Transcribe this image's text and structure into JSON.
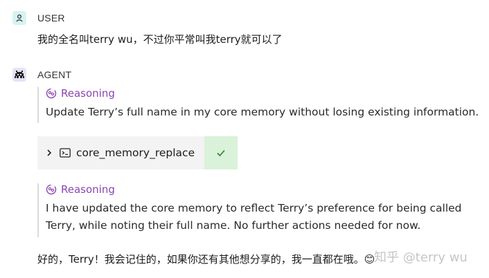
{
  "user": {
    "role_label": "USER",
    "message": "我的全名叫terry wu，不过你平常叫我terry就可以了"
  },
  "agent": {
    "role_label": "AGENT",
    "reasoning_1": {
      "heading": "Reasoning",
      "text": "Update Terry’s full name in my core memory without losing existing information."
    },
    "tool_call": {
      "name": "core_memory_replace",
      "status": "success"
    },
    "reasoning_2": {
      "heading": "Reasoning",
      "line_1": "I have updated the core memory to reflect Terry’s preference for being called",
      "line_2": "Terry, while noting their full name. No further actions needed for now."
    },
    "reply": "好的，Terry！我会记住的，如果你还有其他想分享的，我一直都在哦。😊"
  },
  "watermark": "知乎 @terry wu",
  "colors": {
    "reasoning_accent": "#8b45b3",
    "success_bg": "#d9f2d9",
    "success_check": "#2e7d32",
    "user_icon_bg": "#d8f2f2",
    "agent_icon_bg": "#e6e2f8"
  }
}
